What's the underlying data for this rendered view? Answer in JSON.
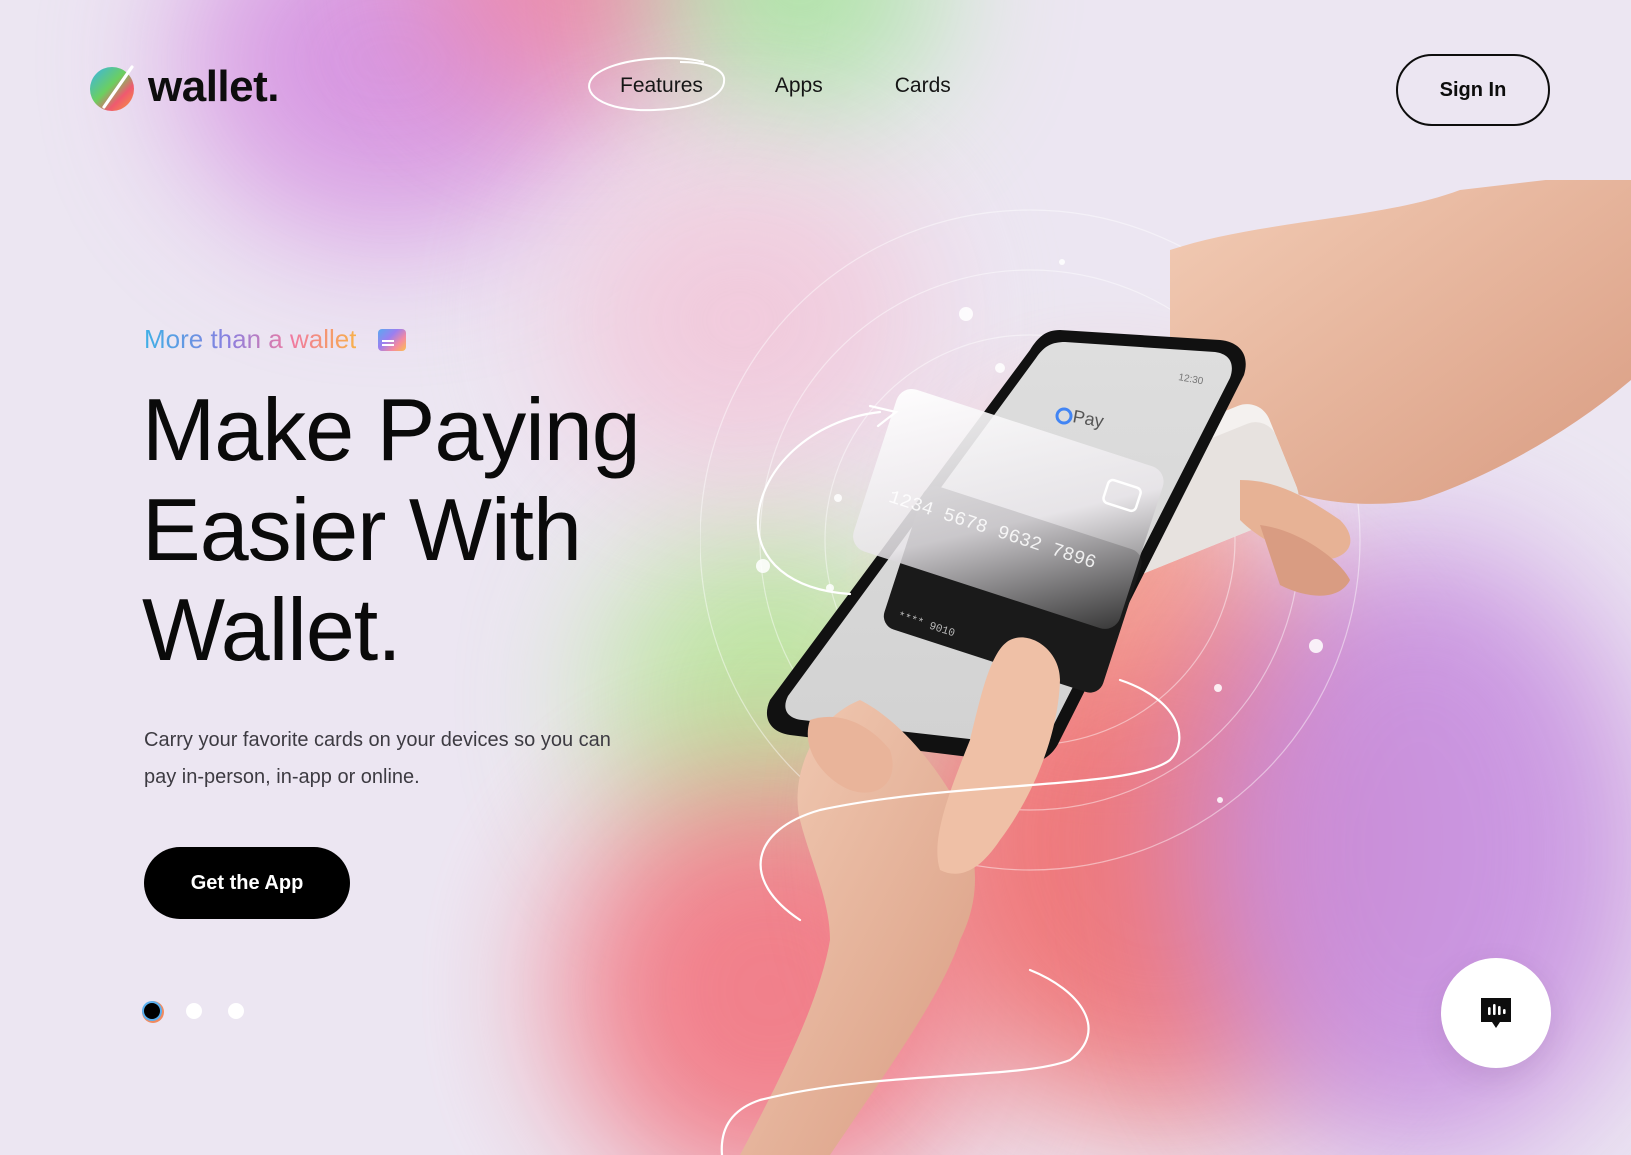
{
  "brand": {
    "name": "wallet."
  },
  "nav": {
    "items": [
      {
        "label": "Features",
        "active": true
      },
      {
        "label": "Apps",
        "active": false
      },
      {
        "label": "Cards",
        "active": false
      }
    ],
    "signin_label": "Sign In"
  },
  "hero": {
    "eyebrow": "More than a wallet",
    "headline_lines": [
      "Make Paying",
      "Easier With",
      "Wallet."
    ],
    "description": "Carry your favorite cards on your devices so you can pay in-person, in-app or online.",
    "cta_label": "Get the App"
  },
  "illustration": {
    "card_number": "1234 5678 9632 7896",
    "back_card_number": "**** 9010",
    "phone_app_label": "Pay",
    "status_time": "12:30"
  },
  "carousel": {
    "total": 3,
    "active_index": 0
  },
  "icons": {
    "logo": "wallet-logo-icon",
    "card": "card-icon",
    "chat": "chat-bubble-icon"
  },
  "colors": {
    "text": "#0d0d0d",
    "cta_bg": "#000000",
    "background": "#ece6f2"
  }
}
